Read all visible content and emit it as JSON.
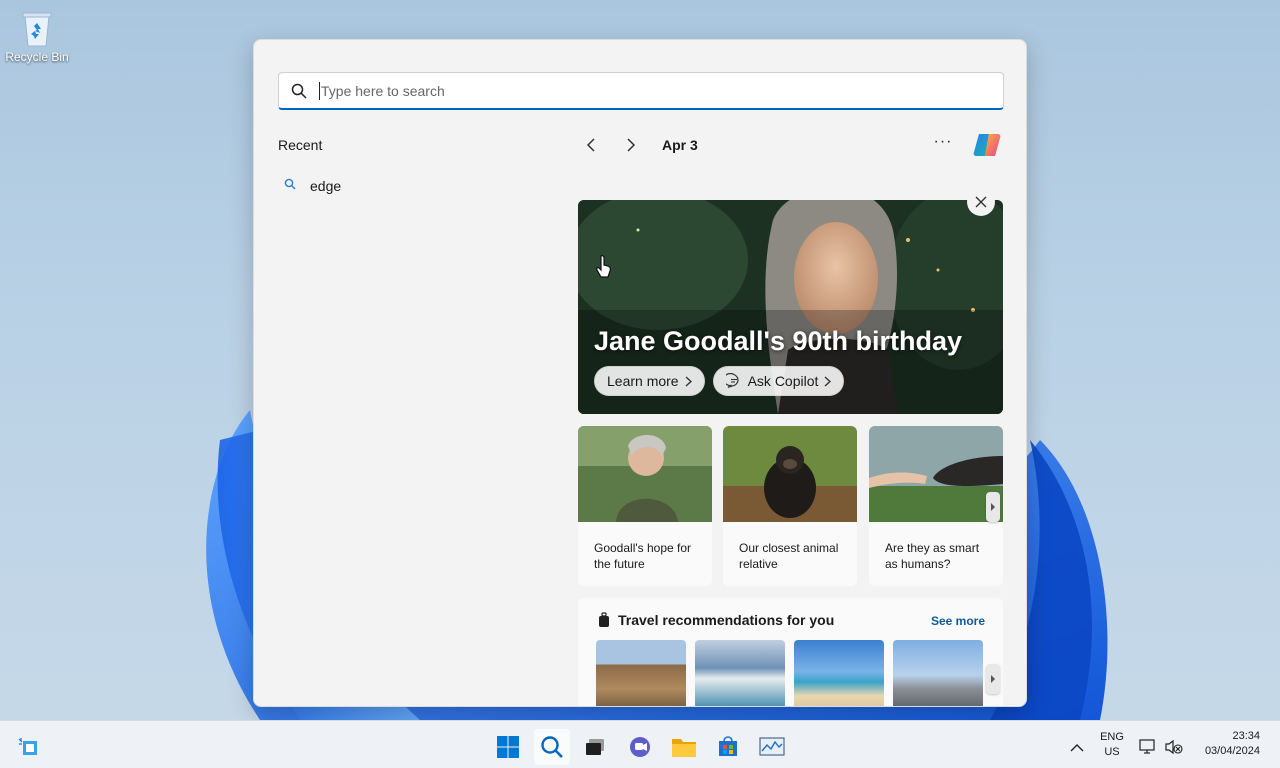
{
  "desktop": {
    "recycle_bin_label": "Recycle Bin"
  },
  "search": {
    "placeholder": "Type here to search",
    "recent_title": "Recent",
    "recent_items": [
      {
        "label": "edge"
      }
    ]
  },
  "nav": {
    "date": "Apr 3",
    "more_label": "···"
  },
  "hero": {
    "title": "Jane Goodall's 90th birthday",
    "learn_more": "Learn more",
    "ask_copilot": "Ask Copilot"
  },
  "cards": [
    {
      "text": "Goodall's hope for the future"
    },
    {
      "text": "Our closest animal relative"
    },
    {
      "text": "Are they as smart as humans?"
    }
  ],
  "travel": {
    "title": "Travel recommendations for you",
    "see_more": "See more"
  },
  "taskbar": {
    "language": "ENG",
    "region": "US",
    "time": "23:34",
    "date": "03/04/2024"
  },
  "colors": {
    "accent": "#0067c0",
    "link": "#0f5a9c"
  }
}
